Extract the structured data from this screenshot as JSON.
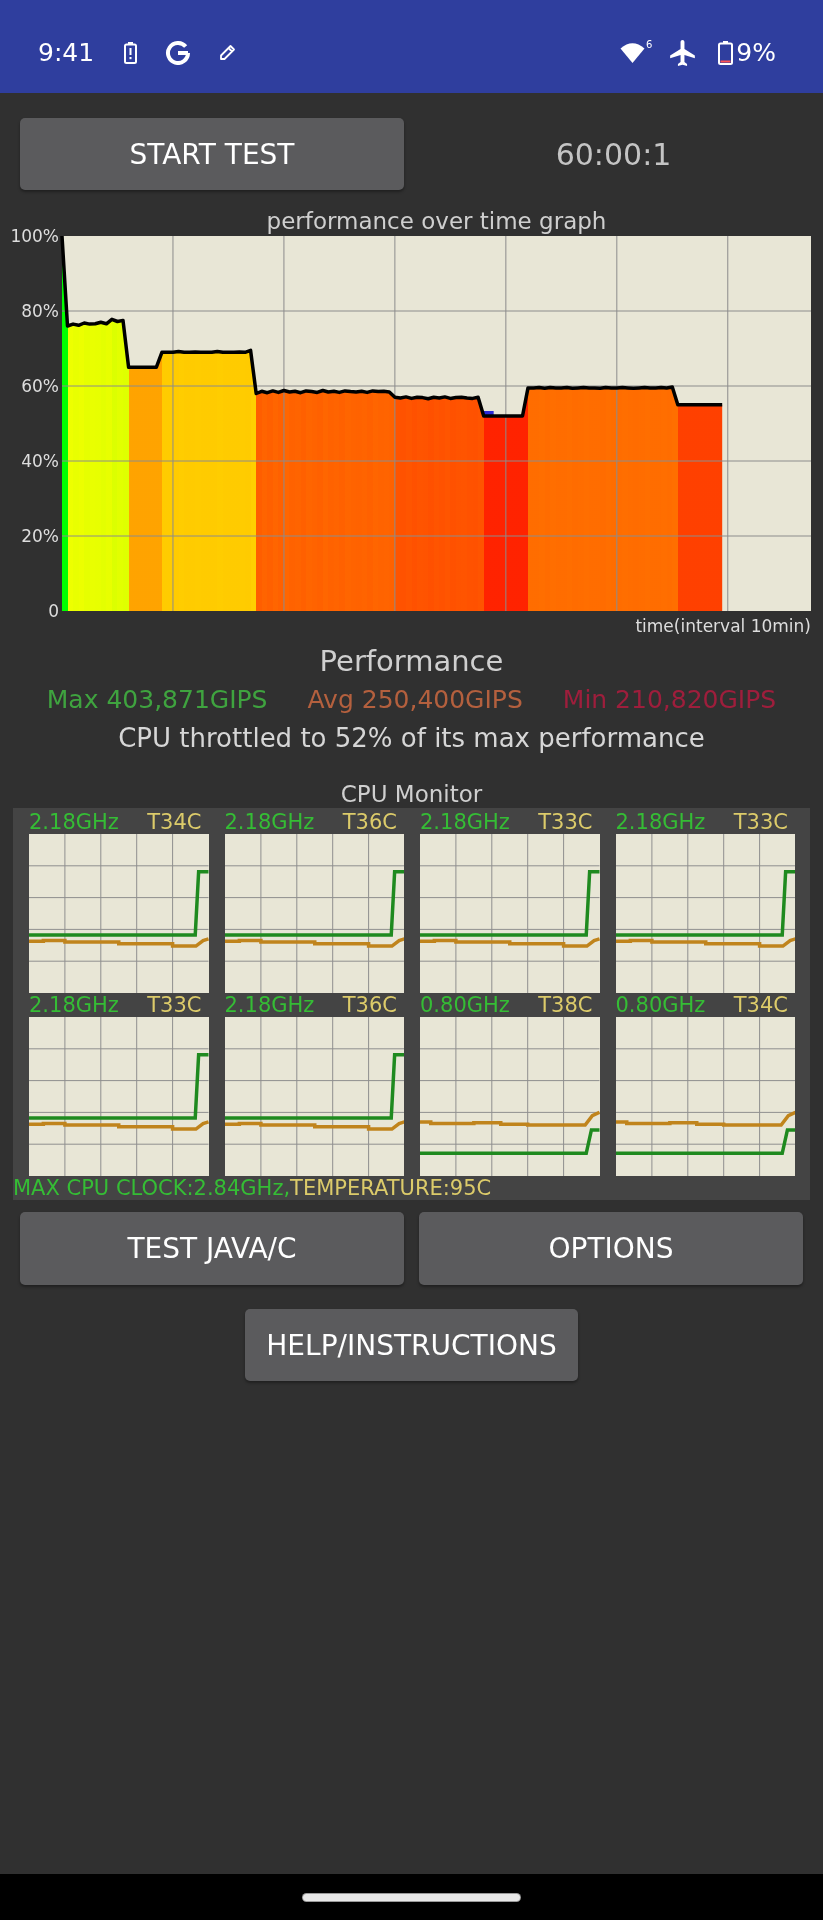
{
  "status_bar": {
    "time": "9:41",
    "wifi_badge": "6",
    "battery": "9%"
  },
  "controls": {
    "start_button": "START TEST",
    "timer": "60:00:1"
  },
  "performance_graph": {
    "chart_data": {
      "type": "area",
      "title": "performance over time graph",
      "xlabel": "time(interval 10min)",
      "categories": [
        null,
        null,
        null,
        null,
        null,
        null,
        null,
        null,
        null,
        null,
        null,
        null,
        null,
        null,
        null,
        null,
        null,
        null,
        null,
        null,
        null,
        null,
        null,
        null,
        null,
        null,
        null,
        null,
        null,
        null,
        null,
        null,
        null,
        null,
        null,
        null,
        null,
        null,
        null,
        null,
        null,
        null,
        null,
        null,
        null,
        null,
        null,
        null,
        null,
        null,
        null,
        null,
        null,
        null,
        null,
        null,
        null,
        null,
        null,
        null,
        null,
        null,
        null,
        null,
        null,
        null,
        null,
        null,
        null,
        null,
        null,
        null,
        null,
        null,
        null,
        null,
        null,
        null,
        null,
        null,
        null,
        null,
        null,
        null,
        null,
        null,
        null,
        null,
        null,
        null,
        null,
        null,
        null,
        null,
        null,
        null,
        null,
        null,
        null,
        null,
        null,
        null,
        null,
        null,
        null,
        null,
        null,
        null,
        null,
        null,
        null,
        null,
        null,
        null,
        null,
        null,
        null,
        null,
        null,
        null,
        null,
        null,
        null,
        null,
        null,
        null,
        null,
        null,
        null,
        null,
        null,
        null,
        null,
        null,
        null,
        null
      ],
      "series": [
        {
          "color": "#000000",
          "values": [
            100,
            76,
            76.5,
            76.2,
            76.8,
            76.5,
            76.6,
            77,
            76.6,
            77.8,
            77.2,
            77.5,
            65,
            65,
            65,
            65,
            65,
            65,
            69,
            69,
            69,
            69.2,
            69,
            69,
            69.1,
            69,
            69,
            69,
            69.2,
            69,
            69,
            69,
            69.1,
            69,
            69.5,
            58,
            58.6,
            58.2,
            58.7,
            58.3,
            58.8,
            58.4,
            58.6,
            58.2,
            58.7,
            58.5,
            58.3,
            58.8,
            58.4,
            58.6,
            58.3,
            58.7,
            58.5,
            58.4,
            58.6,
            58.3,
            58.7,
            58.5,
            58.6,
            58.4,
            57,
            56.8,
            57.1,
            56.7,
            57,
            56.9,
            56.6,
            57,
            56.8,
            57.1,
            56.7,
            56.9,
            57,
            56.8,
            56.7,
            57,
            52,
            52,
            52,
            52,
            52,
            52,
            52,
            52,
            59.5,
            59.5,
            59.6,
            59.4,
            59.6,
            59.5,
            59.5,
            59.6,
            59.4,
            59.5,
            59.6,
            59.5,
            59.5,
            59.4,
            59.6,
            59.5,
            59.5,
            59.6,
            59.5,
            59.4,
            59.5,
            59.6,
            59.5,
            59.5,
            59.6,
            59.5,
            59.7,
            55,
            55,
            55,
            55,
            55,
            55,
            55,
            55,
            55,
            null,
            null,
            null,
            null,
            null,
            null,
            null,
            null,
            null,
            null,
            null,
            null,
            null,
            null,
            null,
            null
          ]
        }
      ],
      "ylim": [
        0,
        100
      ],
      "yticks": [
        {
          "value": 0,
          "label": "0"
        },
        {
          "value": 20,
          "label": "20%"
        },
        {
          "value": 40,
          "label": "40%"
        },
        {
          "value": 60,
          "label": "60%"
        },
        {
          "value": 80,
          "label": "80%"
        },
        {
          "value": 100,
          "label": "100%"
        }
      ],
      "grid": true
    }
  },
  "performance": {
    "title": "Performance",
    "stats": [
      {
        "text": "Max 403,871GIPS",
        "color": "#3fa33f"
      },
      {
        "text": "Avg 250,400GIPS",
        "color": "#b4603e"
      },
      {
        "text": "Min 210,820GIPS",
        "color": "#9e1e3c"
      }
    ],
    "summary": "CPU throttled to 52% of its max performance"
  },
  "cpu_monitor": {
    "title": "CPU Monitor",
    "cores": [
      {
        "frequency": "2.18GHz",
        "temperature": "T34C",
        "kind": "fast"
      },
      {
        "frequency": "2.18GHz",
        "temperature": "T36C",
        "kind": "fast"
      },
      {
        "frequency": "2.18GHz",
        "temperature": "T33C",
        "kind": "fast"
      },
      {
        "frequency": "2.18GHz",
        "temperature": "T33C",
        "kind": "fast"
      },
      {
        "frequency": "2.18GHz",
        "temperature": "T33C",
        "kind": "fast"
      },
      {
        "frequency": "2.18GHz",
        "temperature": "T36C",
        "kind": "fast"
      },
      {
        "frequency": "0.80GHz",
        "temperature": "T38C",
        "kind": "slow"
      },
      {
        "frequency": "0.80GHz",
        "temperature": "T34C",
        "kind": "slow"
      }
    ],
    "max_clock": "MAX CPU CLOCK:2.84GHz,",
    "max_temperature": "TEMPERATURE:95C"
  },
  "buttons": [
    "TEST JAVA/C",
    "OPTIONS",
    "HELP/INSTRUCTIONS"
  ]
}
